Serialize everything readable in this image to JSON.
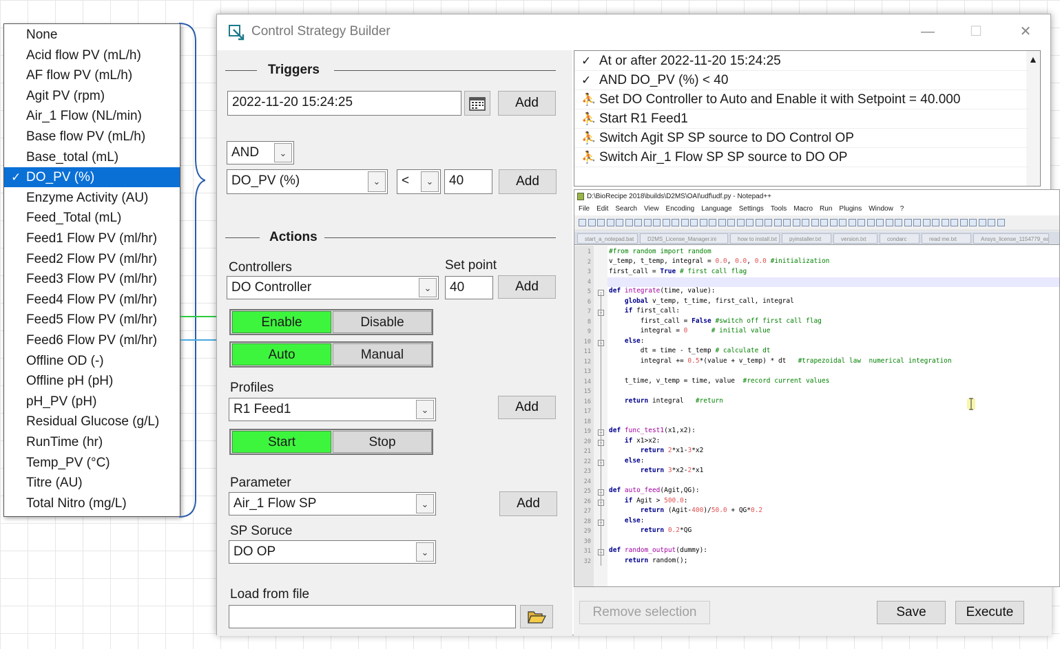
{
  "dropdown": {
    "items": [
      {
        "label": "None",
        "selected": false
      },
      {
        "label": "Acid flow PV (mL/h)",
        "selected": false
      },
      {
        "label": "AF flow PV (mL/h)",
        "selected": false
      },
      {
        "label": "Agit PV (rpm)",
        "selected": false
      },
      {
        "label": "Air_1 Flow (NL/min)",
        "selected": false
      },
      {
        "label": "Base flow PV (mL/h)",
        "selected": false
      },
      {
        "label": "Base_total (mL)",
        "selected": false
      },
      {
        "label": "DO_PV (%)",
        "selected": true
      },
      {
        "label": "Enzyme Activity (AU)",
        "selected": false
      },
      {
        "label": "Feed_Total (mL)",
        "selected": false
      },
      {
        "label": "Feed1 Flow PV (ml/hr)",
        "selected": false
      },
      {
        "label": "Feed2 Flow PV (ml/hr)",
        "selected": false
      },
      {
        "label": "Feed3 Flow PV (ml/hr)",
        "selected": false
      },
      {
        "label": "Feed4 Flow PV (ml/hr)",
        "selected": false
      },
      {
        "label": "Feed5 Flow PV (ml/hr)",
        "selected": false
      },
      {
        "label": "Feed6 Flow PV (ml/hr)",
        "selected": false
      },
      {
        "label": "Offline OD (-)",
        "selected": false
      },
      {
        "label": "Offline pH (pH)",
        "selected": false
      },
      {
        "label": "pH_PV (pH)",
        "selected": false
      },
      {
        "label": "Residual Glucose (g/L)",
        "selected": false
      },
      {
        "label": "RunTime (hr)",
        "selected": false
      },
      {
        "label": "Temp_PV (°C)",
        "selected": false
      },
      {
        "label": "Titre (AU)",
        "selected": false
      },
      {
        "label": "Total Nitro (mg/L)",
        "selected": false
      }
    ],
    "check_mark": "✓"
  },
  "window": {
    "title": "Control Strategy Builder",
    "minimize": "—",
    "maximize": "☐",
    "close": "✕"
  },
  "triggers": {
    "section_title": "Triggers",
    "datetime_value": "2022-11-20 15:24:25",
    "add_label": "Add",
    "logic_value": "AND",
    "variable_value": "DO_PV (%)",
    "operator_value": "<",
    "threshold_value": "40",
    "add2_label": "Add"
  },
  "actions": {
    "section_title": "Actions",
    "controllers_label": "Controllers",
    "setpoint_label": "Set point",
    "controller_value": "DO Controller",
    "setpoint_value": "40",
    "add_label": "Add",
    "enable_label": "Enable",
    "disable_label": "Disable",
    "auto_label": "Auto",
    "manual_label": "Manual",
    "profiles_label": "Profiles",
    "profile_value": "R1 Feed1",
    "profile_add_label": "Add",
    "start_label": "Start",
    "stop_label": "Stop",
    "parameter_label": "Parameter",
    "parameter_value": "Air_1 Flow SP",
    "parameter_add_label": "Add",
    "sp_source_label": "SP Soruce",
    "sp_source_value": "DO OP",
    "load_label": "Load from file",
    "load_value": ""
  },
  "strategy_list": [
    {
      "icon": "check",
      "glyph": "✓",
      "text": "At or after  2022-11-20 15:24:25"
    },
    {
      "icon": "check",
      "glyph": "✓",
      "text": "AND DO_PV (%) < 40"
    },
    {
      "icon": "runner",
      "glyph": "⛹",
      "text": "Set DO Controller to Auto and Enable it with Setpoint = 40.000"
    },
    {
      "icon": "runner",
      "glyph": "⛹",
      "text": "Start  R1 Feed1"
    },
    {
      "icon": "runner",
      "glyph": "⛹",
      "text": "Switch Agit SP SP source to DO Control OP"
    },
    {
      "icon": "runner",
      "glyph": "⛹",
      "text": "Switch Air_1 Flow SP SP source to DO OP"
    }
  ],
  "notepad": {
    "title": "D:\\BioRecipe 2018\\builds\\D2MS\\OAI\\udf\\udf.py - Notepad++",
    "menu": [
      "File",
      "Edit",
      "Search",
      "View",
      "Encoding",
      "Language",
      "Settings",
      "Tools",
      "Macro",
      "Run",
      "Plugins",
      "Window",
      "?"
    ],
    "tabs": [
      "start_a_notepad.bat",
      "D2MS_License_Manager.ini",
      "how to install.txt",
      "pyinstaller.txt",
      "version.txt",
      "condarc",
      "read me.txt",
      "Ansys_license_1154779_ea"
    ],
    "line_numbers": [
      "1",
      "2",
      "3",
      "4",
      "5",
      "6",
      "7",
      "8",
      "9",
      "10",
      "11",
      "12",
      "13",
      "14",
      "15",
      "16",
      "17",
      "18",
      "19",
      "20",
      "21",
      "22",
      "23",
      "24",
      "25",
      "26",
      "27",
      "28",
      "29",
      "30",
      "31",
      "32"
    ]
  },
  "bottom": {
    "remove_label": "Remove selection",
    "save_label": "Save",
    "execute_label": "Execute"
  },
  "colors": {
    "selection": "#0a70d6",
    "toggle_on": "#3ef53e",
    "panel_bg": "#f0f0f0"
  }
}
